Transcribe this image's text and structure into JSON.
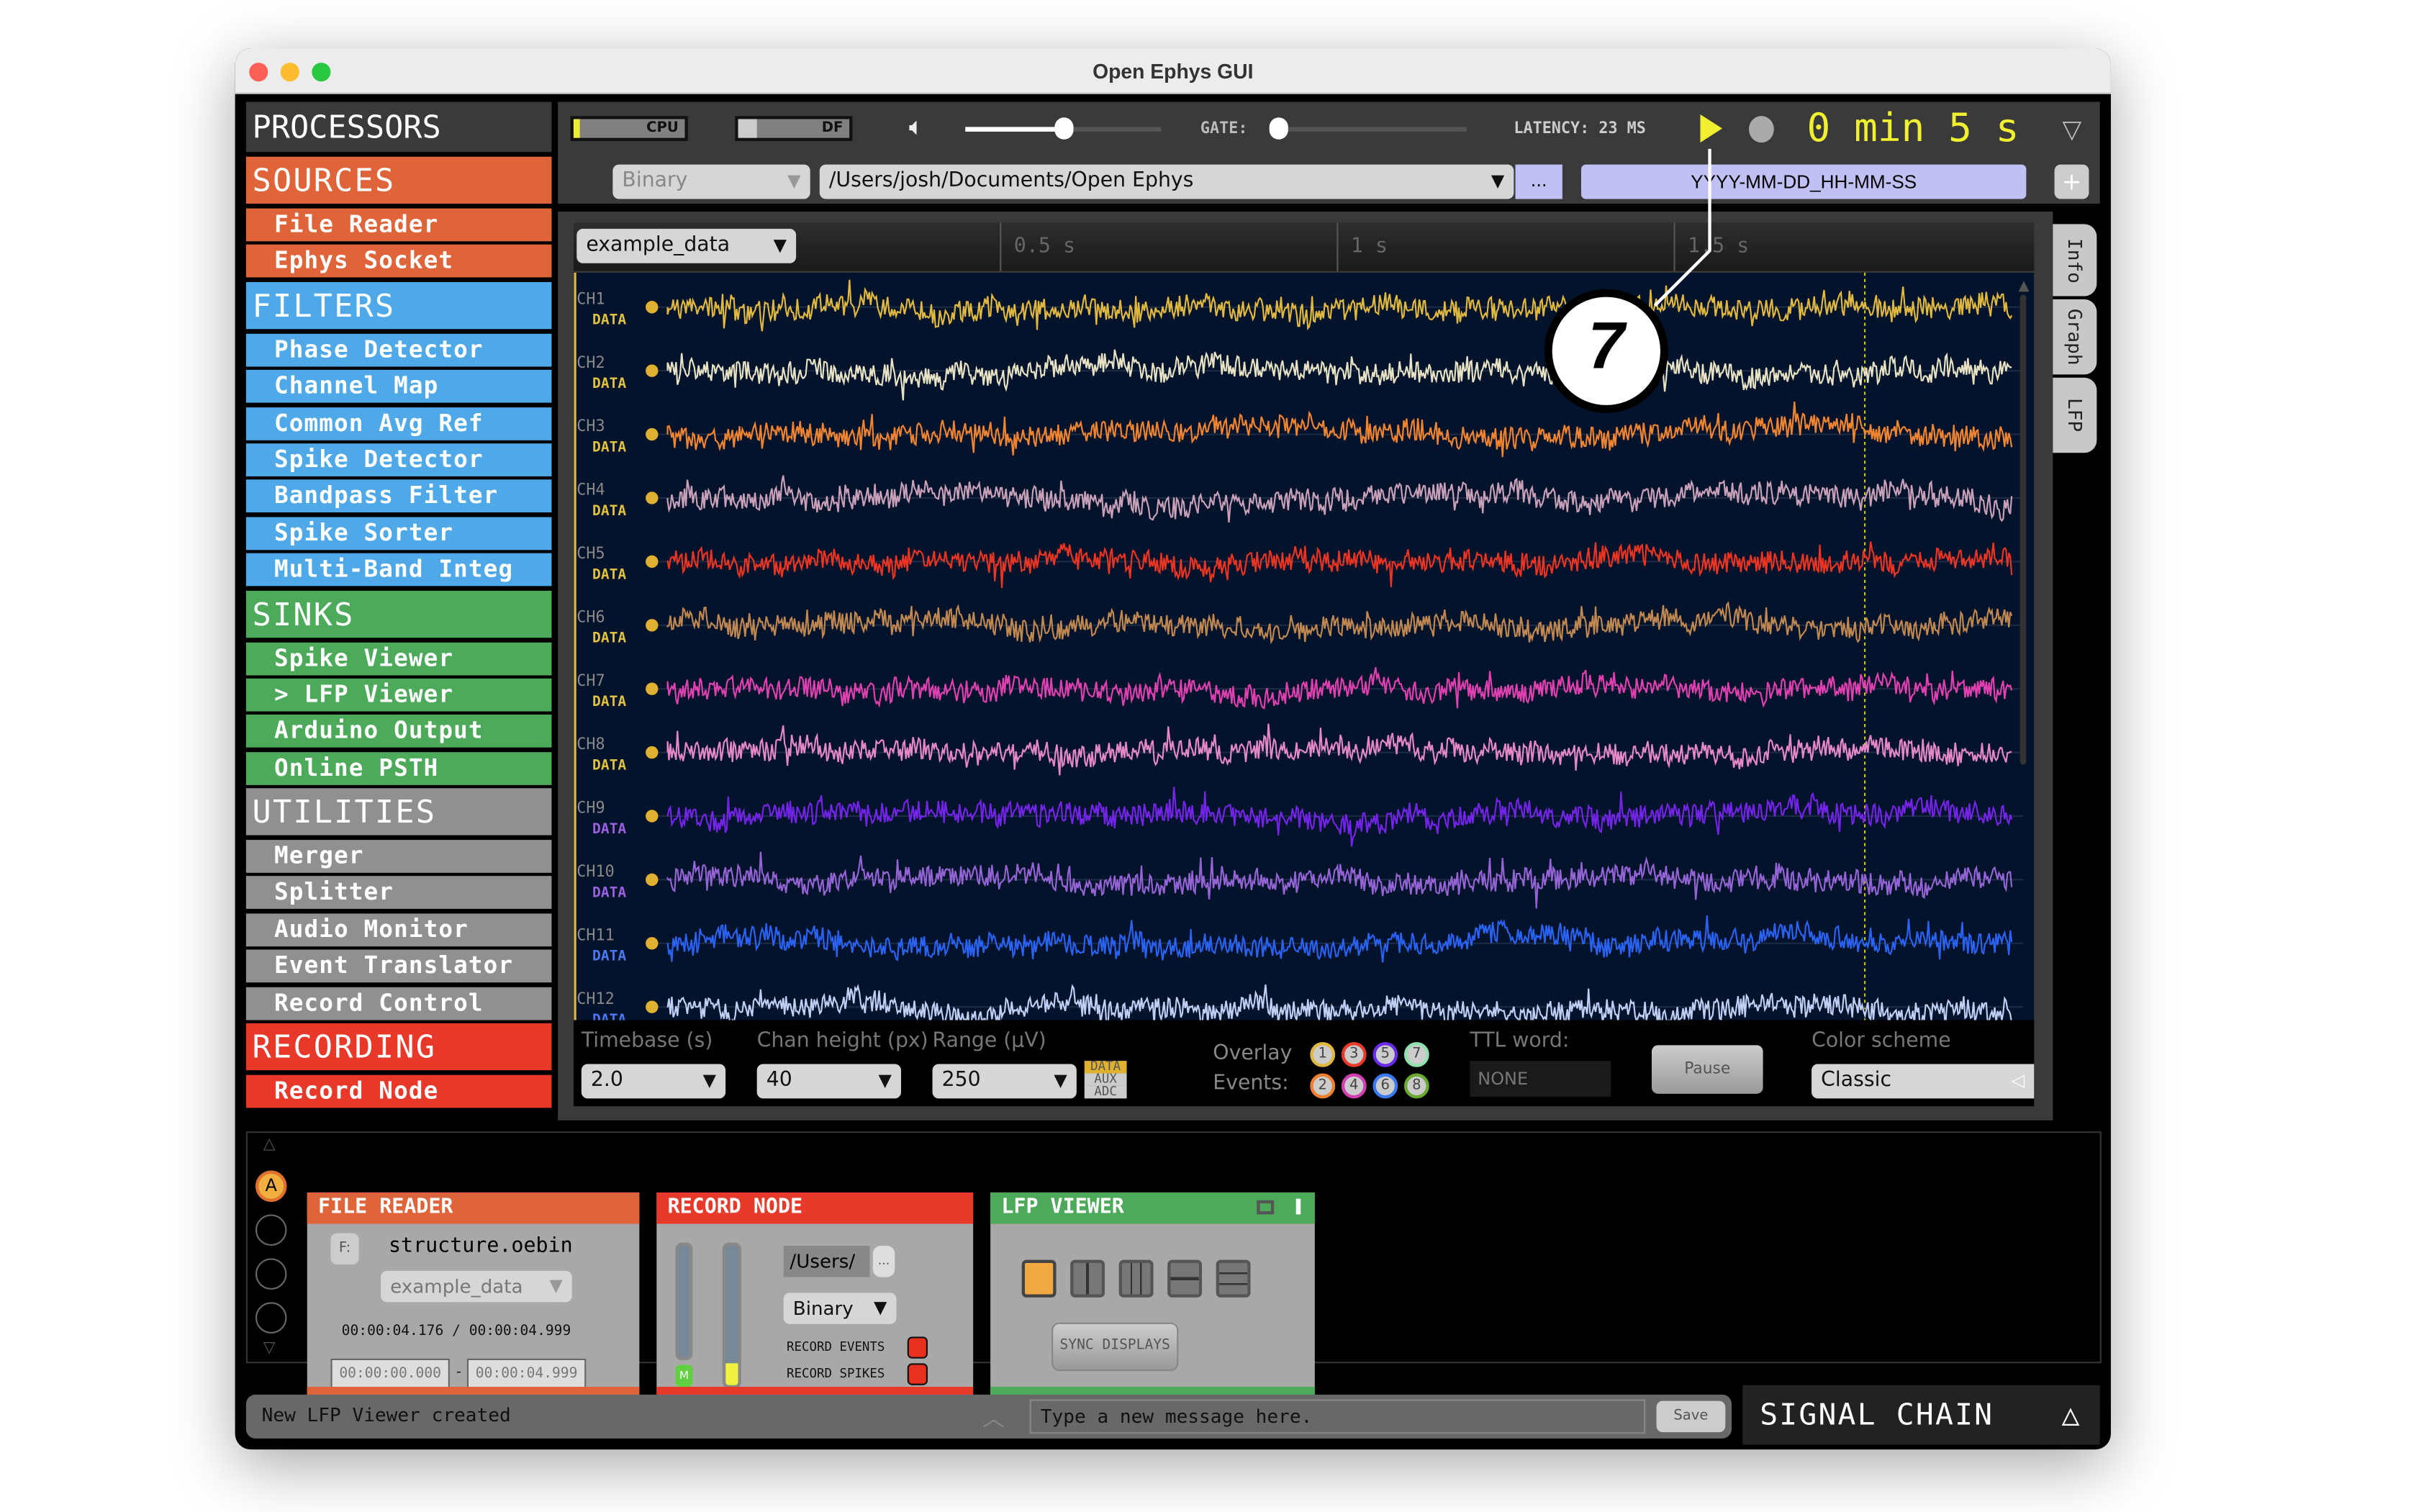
{
  "window": {
    "title": "Open Ephys GUI"
  },
  "processors": {
    "title": "PROCESSORS",
    "groups": [
      {
        "name": "SOURCES",
        "color": "#e0643a",
        "items": [
          "File Reader",
          "Ephys Socket"
        ]
      },
      {
        "name": "FILTERS",
        "color": "#4fa8e8",
        "items": [
          "Phase Detector",
          "Channel Map",
          "Common Avg Ref",
          "Spike Detector",
          "Bandpass Filter",
          "Spike Sorter",
          "Multi-Band Integ"
        ]
      },
      {
        "name": "SINKS",
        "color": "#4caa5a",
        "items": [
          "Spike Viewer",
          "> LFP Viewer",
          "Arduino Output",
          "Online PSTH"
        ]
      },
      {
        "name": "UTILITIES",
        "color": "#909090",
        "items": [
          "Merger",
          "Splitter",
          "Audio Monitor",
          "Event Translator",
          "Record Control"
        ]
      },
      {
        "name": "RECORDING",
        "color": "#e8382a",
        "items": [
          "Record Node"
        ]
      }
    ]
  },
  "control": {
    "cpu": "CPU",
    "df": "DF",
    "cpu_level": 0.02,
    "volume_level": 0.5,
    "gate_label": "GATE:",
    "gate_level": 0,
    "latency": "LATENCY: 23 MS",
    "clock": "0 min 5 s",
    "engine": "Binary",
    "path": "/Users/josh/Documents/Open Ephys",
    "browse": "...",
    "directory_format": "YYYY-MM-DD_HH-MM-SS",
    "add": "+"
  },
  "lfp": {
    "stream": "example_data",
    "time_ticks": [
      "0.5 s",
      "1 s",
      "1.5 s"
    ],
    "channels": [
      {
        "name": "CH1",
        "type": "DATA",
        "color": "#e0b840"
      },
      {
        "name": "CH2",
        "type": "DATA",
        "color": "#e8e2c4"
      },
      {
        "name": "CH3",
        "type": "DATA",
        "color": "#f08430"
      },
      {
        "name": "CH4",
        "type": "DATA",
        "color": "#c8a0b8"
      },
      {
        "name": "CH5",
        "type": "DATA",
        "color": "#ec3422"
      },
      {
        "name": "CH6",
        "type": "DATA",
        "color": "#c08850"
      },
      {
        "name": "CH7",
        "type": "DATA",
        "color": "#e040b0"
      },
      {
        "name": "CH8",
        "type": "DATA",
        "color": "#e488c8"
      },
      {
        "name": "CH9",
        "type": "DATA",
        "color": "#7424e8"
      },
      {
        "name": "CH10",
        "type": "DATA",
        "color": "#9464d4"
      },
      {
        "name": "CH11",
        "type": "DATA",
        "color": "#2a62f4"
      },
      {
        "name": "CH12",
        "type": "DATA",
        "color": "#c0cef4"
      }
    ],
    "controls": {
      "timebase_label": "Timebase (s)",
      "timebase": "2.0",
      "chan_height_label": "Chan height (px)",
      "chan_height": "40",
      "range_label": "Range (µV)",
      "range": "250",
      "types": [
        "DATA",
        "AUX",
        "ADC"
      ],
      "overlay_label": "Overlay",
      "events_label": "Events:",
      "events": [
        {
          "n": "1",
          "color": "#e0b840"
        },
        {
          "n": "3",
          "color": "#e83a2a"
        },
        {
          "n": "5",
          "color": "#6a2ae8"
        },
        {
          "n": "7",
          "color": "#90e0b0"
        },
        {
          "n": "2",
          "color": "#f08030"
        },
        {
          "n": "4",
          "color": "#d040b0"
        },
        {
          "n": "6",
          "color": "#3a7af0"
        },
        {
          "n": "8",
          "color": "#6aaa30"
        }
      ],
      "ttl_label": "TTL word:",
      "ttl": "NONE",
      "pause": "Pause",
      "color_scheme_label": "Color scheme",
      "color_scheme": "Classic"
    },
    "tabs": [
      "Info",
      "Graph",
      "LFP"
    ]
  },
  "annotation": "7",
  "signal_chain": {
    "slot_a": "A",
    "file_reader": {
      "title": "FILE READER",
      "drive": "F:",
      "file": "structure.oebin",
      "stream": "example_data",
      "current": "00:00:04.176",
      "sep": "/",
      "total": "00:00:04.999",
      "start": "00:00:00.000",
      "dash": "-",
      "end": "00:00:04.999"
    },
    "record_node": {
      "title": "RECORD NODE",
      "path": "/Users/",
      "browse": "...",
      "engine": "Binary",
      "m": "M",
      "rec_events": "RECORD EVENTS",
      "rec_spikes": "RECORD SPIKES"
    },
    "lfp_viewer": {
      "title": "LFP VIEWER",
      "sync": "SYNC DISPLAYS"
    }
  },
  "status": {
    "message": "New LFP Viewer created",
    "input_placeholder": "Type a new message here.",
    "save": "Save",
    "signal_chain": "SIGNAL CHAIN"
  }
}
